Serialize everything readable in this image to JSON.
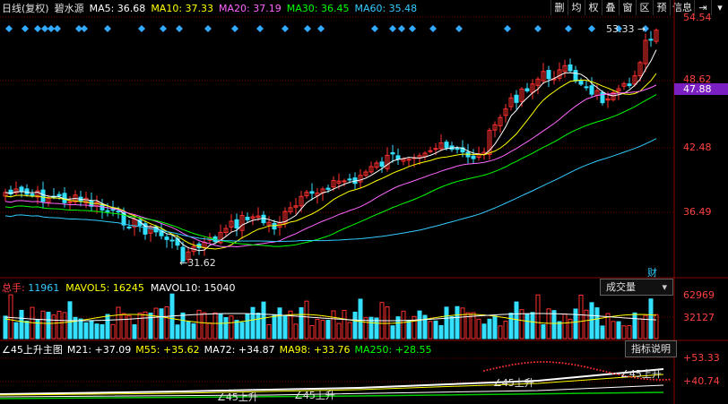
{
  "header": {
    "period": "日线(复权)",
    "stock_name": "碧水源",
    "ma_items": [
      {
        "label": "MA5: 36.68",
        "color": "#ffffff"
      },
      {
        "label": "MA10: 37.33",
        "color": "#ffff00"
      },
      {
        "label": "MA20: 37.19",
        "color": "#ff66ff"
      },
      {
        "label": "MA30: 36.45",
        "color": "#00ff00"
      },
      {
        "label": "MA60: 35.48",
        "color": "#33ccff"
      }
    ]
  },
  "toolbar": {
    "items": [
      "删",
      "均",
      "权",
      "叠",
      "窗",
      "区",
      "预",
      "信息"
    ],
    "expand_icon": "arrow-right-bar-icon",
    "menu_icon": "chevron-down-icon"
  },
  "price_axis": {
    "labels": [
      "54.54",
      "48.62",
      "42.48",
      "36.49"
    ],
    "current_price": "47.88",
    "annotations": {
      "high": "53.33",
      "low": "31.62"
    },
    "finance_marker": "财"
  },
  "volume_panel": {
    "legend": [
      {
        "label": "总手: 11961",
        "color": "#ff4040",
        "part": "总手: ",
        "value_color": "#33ccff",
        "value": "11961"
      },
      {
        "label": "MAVOL5: 16245",
        "color": "#ffff00"
      },
      {
        "label": "MAVOL10: 15040",
        "color": "#ffffff"
      }
    ],
    "selector_label": "成交量",
    "axis_labels": [
      "62969",
      "32127"
    ]
  },
  "indicator_panel": {
    "legend": [
      {
        "label": "∠45上升主图",
        "color": "#ffffff"
      },
      {
        "label": "M21: +37.09",
        "color": "#ffffff"
      },
      {
        "label": "M55: +35.62",
        "color": "#ffff00"
      },
      {
        "label": "MA72: +34.87",
        "color": "#ffffff"
      },
      {
        "label": "MA98: +33.76",
        "color": "#ffff00"
      },
      {
        "label": "MA250: +28.55",
        "color": "#00ff00"
      }
    ],
    "help_label": "指标说明",
    "axis_labels": [
      "+53.33",
      "+40.74"
    ],
    "signal_labels": [
      "∠45上升",
      "∠45上升",
      "∠45上升",
      "∠45上升"
    ]
  },
  "colors": {
    "up": "#ff3030",
    "down": "#33e0ff",
    "bg": "#000000",
    "grid": "#7a0000"
  }
}
